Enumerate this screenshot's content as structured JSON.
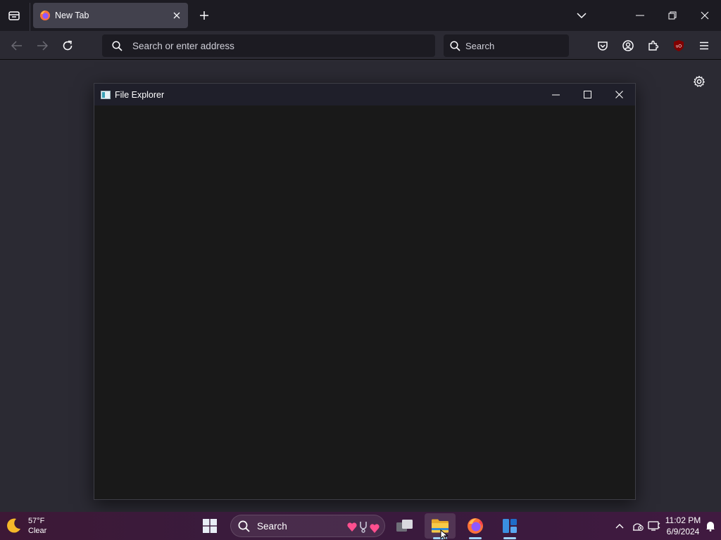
{
  "browser": {
    "tab": {
      "title": "New Tab"
    },
    "urlbar": {
      "placeholder": "Search or enter address"
    },
    "searchbar": {
      "placeholder": "Search"
    },
    "icons": [
      "firefox-view-icon",
      "firefox-icon",
      "close-icon",
      "plus-icon",
      "chevron-down-icon",
      "minimize-icon",
      "restore-icon",
      "close-icon",
      "back-arrow-icon",
      "forward-arrow-icon",
      "reload-icon",
      "search-icon",
      "pocket-icon",
      "account-icon",
      "extensions-icon",
      "ublock-icon",
      "hamburger-menu-icon",
      "gear-icon"
    ],
    "ublock_badge": "uO"
  },
  "explorer": {
    "title": "File Explorer"
  },
  "taskbar": {
    "weather": {
      "temp": "57°F",
      "condition": "Clear"
    },
    "search": {
      "label": "Search"
    },
    "clock": {
      "time": "11:02 PM",
      "date": "6/9/2024"
    },
    "colors": {
      "accent": "#9fd6ff",
      "firefox": "#ff7139",
      "explorer": "#f7c948"
    }
  }
}
